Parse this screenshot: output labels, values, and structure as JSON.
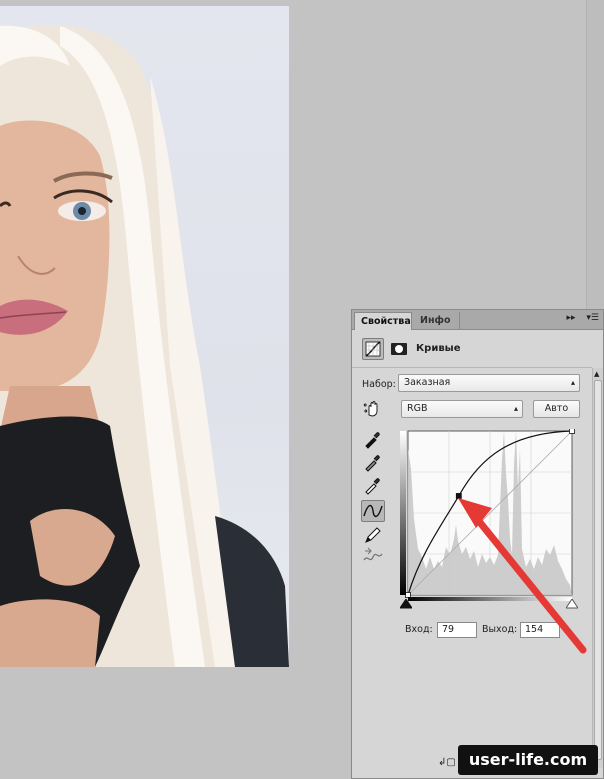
{
  "panel": {
    "tabs": [
      {
        "label": "Свойства",
        "active": true
      },
      {
        "label": "Инфо",
        "active": false
      }
    ],
    "controls": {
      "collapse": "▸▸",
      "menu": "▾☰"
    },
    "title": "Кривые",
    "preset": {
      "label": "Набор:",
      "value": "Заказная"
    },
    "channel": {
      "value": "RGB"
    },
    "auto_label": "Авто",
    "input": {
      "label": "Вход:",
      "value": "79"
    },
    "output": {
      "label": "Выход:",
      "value": "154"
    },
    "icons": {
      "header": [
        "curves-adjustment-icon",
        "layer-mask-icon"
      ],
      "tools": [
        "targeted-adjustment-hand-icon",
        "black-point-eyedropper-icon",
        "gray-point-eyedropper-icon",
        "white-point-eyedropper-icon",
        "curve-edit-icon",
        "pencil-icon",
        "smooth-icon"
      ]
    }
  },
  "curve": {
    "points": [
      [
        0,
        0
      ],
      [
        79,
        154
      ],
      [
        255,
        255
      ]
    ]
  },
  "watermark": "user-life.com",
  "colors": {
    "annotation_arrow": "#e53935",
    "panel_bg": "#d6d6d6",
    "canvas_bg": "#c3c3c3"
  }
}
